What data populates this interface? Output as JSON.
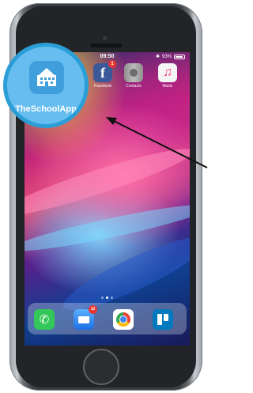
{
  "status_bar": {
    "time": "09:50",
    "battery_text": "93%",
    "battery_level": 0.93
  },
  "home_screen": {
    "apps": [
      {
        "name": "Facebook",
        "label": "Facebook",
        "badge": "1",
        "icon": "facebook-icon",
        "color": "#3b5998"
      },
      {
        "name": "Contacts",
        "label": "Contacts",
        "badge": "",
        "icon": "contacts-icon",
        "color": "#9c9c9c"
      },
      {
        "name": "Music",
        "label": "Music",
        "badge": "",
        "icon": "music-icon",
        "color": "#f5f5f7"
      }
    ],
    "page_dots": 3,
    "active_page": 2
  },
  "dock": [
    {
      "name": "Phone",
      "icon": "phone-icon",
      "color": "#34c759",
      "badge": ""
    },
    {
      "name": "Mail",
      "icon": "mail-icon",
      "color": "#2f8bf4",
      "badge": "12"
    },
    {
      "name": "Chrome",
      "icon": "chrome-icon",
      "color": "#ffffff",
      "badge": ""
    },
    {
      "name": "Trello",
      "icon": "trello-icon",
      "color": "#0079bf",
      "badge": ""
    }
  ],
  "callout": {
    "label": "TheSchoolApp",
    "icon": "school-building-icon",
    "circle_color": "#2b9ed8"
  }
}
